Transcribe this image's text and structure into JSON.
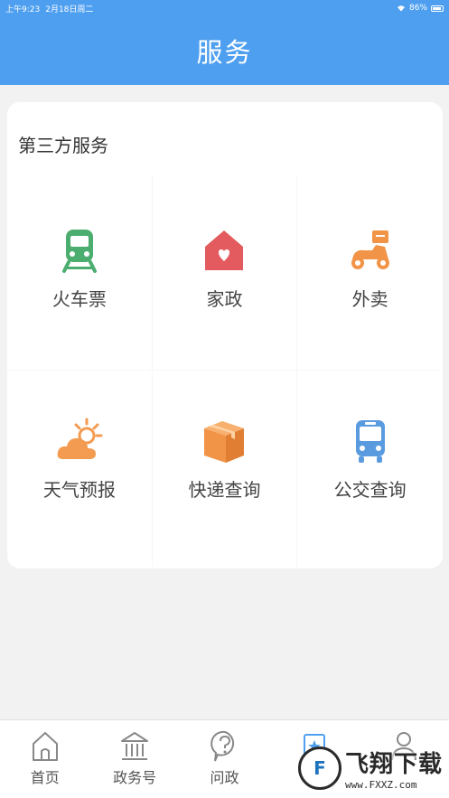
{
  "status_bar": {
    "time": "上午9:23",
    "date": "2月18日周二",
    "battery": "86%"
  },
  "header": {
    "title": "服务"
  },
  "card": {
    "section_title": "第三方服务",
    "services": [
      {
        "label": "火车票",
        "icon": "train-icon",
        "color": "#4cae6e"
      },
      {
        "label": "家政",
        "icon": "house-heart-icon",
        "color": "#e35b5f"
      },
      {
        "label": "外卖",
        "icon": "scooter-icon",
        "color": "#f29448"
      },
      {
        "label": "天气预报",
        "icon": "sun-cloud-icon",
        "color": "#f39b50"
      },
      {
        "label": "快递查询",
        "icon": "package-icon",
        "color": "#f29448"
      },
      {
        "label": "公交查询",
        "icon": "bus-icon",
        "color": "#5a9be0"
      }
    ]
  },
  "tabbar": {
    "items": [
      {
        "label": "首页",
        "icon": "home-icon"
      },
      {
        "label": "政务号",
        "icon": "government-building-icon"
      },
      {
        "label": "问政",
        "icon": "question-icon"
      },
      {
        "label": "",
        "icon": "service-icon"
      },
      {
        "label": "",
        "icon": "user-icon"
      }
    ]
  },
  "watermark": {
    "name": "飞翔下载",
    "url": "www.FXXZ.com"
  },
  "colors": {
    "accent": "#4e9ff0",
    "background": "#f2f2f2"
  }
}
